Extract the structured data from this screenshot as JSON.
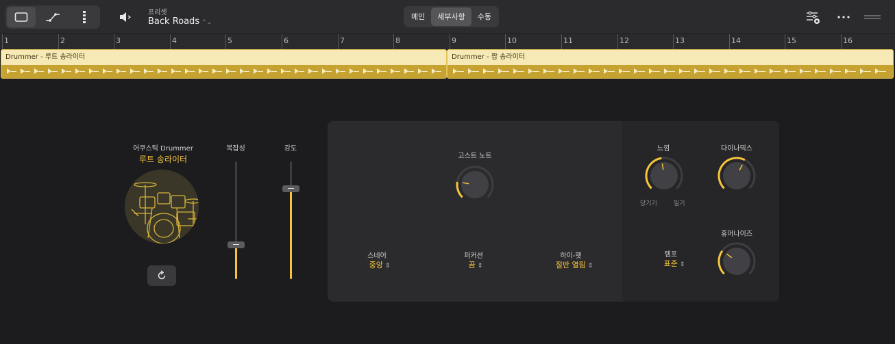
{
  "toolbar": {
    "preset_label": "프리셋",
    "preset_name": "Back Roads",
    "tabs": [
      {
        "label": "메인",
        "active": false
      },
      {
        "label": "세부사항",
        "active": true
      },
      {
        "label": "수동",
        "active": false
      }
    ],
    "icons": [
      "rectangle-view-icon",
      "automation-curve-icon",
      "drum-lane-icon",
      "speaker-icon",
      "mixer-settings-icon",
      "more-icon",
      "drag-handle-icon"
    ]
  },
  "ruler": {
    "bars": [
      "1",
      "2",
      "3",
      "4",
      "5",
      "6",
      "7",
      "8",
      "9",
      "10",
      "11",
      "12",
      "13",
      "14",
      "15",
      "16"
    ]
  },
  "regions": [
    {
      "name": "Drummer - 루트 송라이터"
    },
    {
      "name": "Drummer - 팝 송라이터"
    }
  ],
  "drummer": {
    "kit_title": "어쿠스틱 Drummer",
    "kit_name": "루트 송라이터"
  },
  "sliders": [
    {
      "label": "복잡성",
      "value": 0.29
    },
    {
      "label": "강도",
      "value": 0.77
    }
  ],
  "knobs": {
    "ghost_notes": {
      "label": "고스트 노트",
      "value": 0.2
    },
    "feel": {
      "label": "느낌",
      "value": 0.47,
      "left_label": "당기기",
      "right_label": "밀기"
    },
    "dynamics": {
      "label": "다이나믹스",
      "value": 0.6
    },
    "humanize": {
      "label": "휴머나이즈",
      "value": 0.3
    }
  },
  "selectors": {
    "snare": {
      "title": "스네어",
      "value": "중앙"
    },
    "percussion": {
      "title": "퍼커션",
      "value": "끔"
    },
    "hihat": {
      "title": "하이-햇",
      "value": "절반 열림"
    },
    "tempo": {
      "title": "템포",
      "value": "표준"
    }
  },
  "colors": {
    "accent": "#f6c53a",
    "region": "#c6a331",
    "region_header": "#f6e9b5",
    "background": "#1c1c1e"
  }
}
